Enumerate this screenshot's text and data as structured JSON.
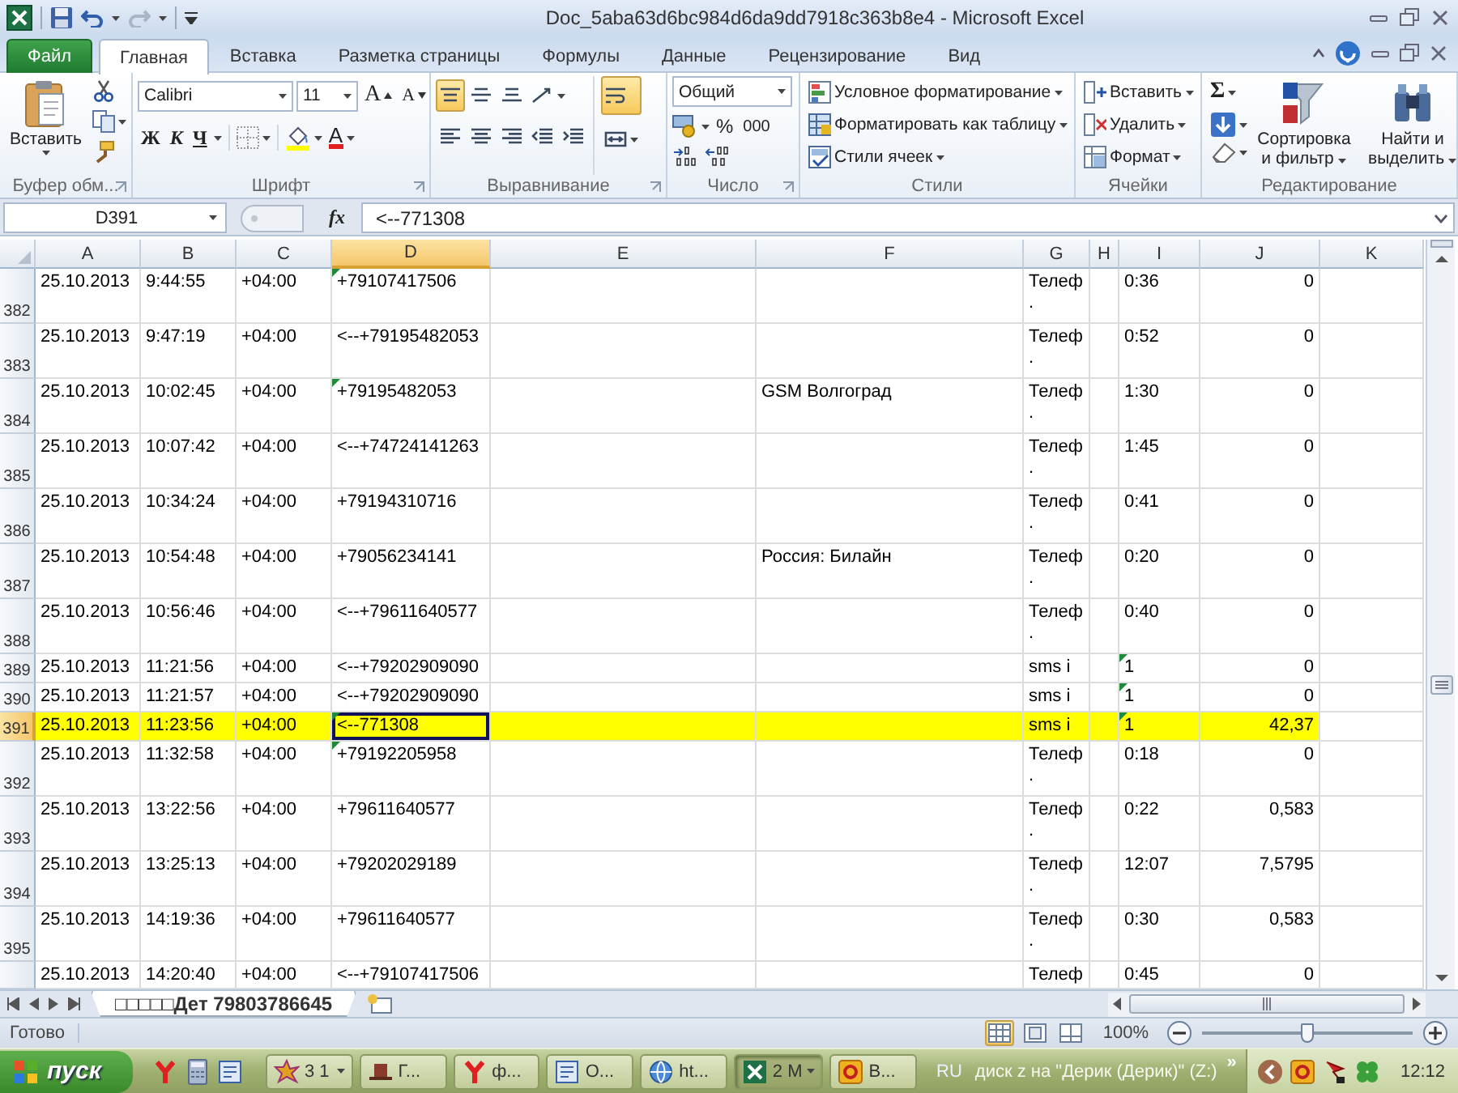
{
  "window": {
    "title": "Doc_5aba63d6bc984d6da9dd7918c363b8e4 - Microsoft Excel"
  },
  "tabs": [
    {
      "label": "Файл",
      "kind": "file",
      "selected": false
    },
    {
      "label": "Главная",
      "kind": "tab",
      "selected": true
    },
    {
      "label": "Вставка",
      "kind": "tab",
      "selected": false
    },
    {
      "label": "Разметка страницы",
      "kind": "tab",
      "selected": false
    },
    {
      "label": "Формулы",
      "kind": "tab",
      "selected": false
    },
    {
      "label": "Данные",
      "kind": "tab",
      "selected": false
    },
    {
      "label": "Рецензирование",
      "kind": "tab",
      "selected": false
    },
    {
      "label": "Вид",
      "kind": "tab",
      "selected": false
    }
  ],
  "ribbon": {
    "clipboard": {
      "label": "Буфер обм...",
      "paste": "Вставить"
    },
    "font": {
      "label": "Шрифт",
      "name": "Calibri",
      "size": "11",
      "grow": "A",
      "shrink": "A",
      "bold": "Ж",
      "italic": "К",
      "underline": "Ч",
      "font_color_label": "A"
    },
    "alignment": {
      "label": "Выравнивание",
      "buttons": [
        {
          "kind": "top",
          "selected": true
        },
        {
          "kind": "middle",
          "selected": false
        },
        {
          "kind": "bottom",
          "selected": false
        },
        {
          "kind": "orientation",
          "selected": false
        },
        {
          "kind": "wrap",
          "selected": true
        },
        {
          "kind": "left",
          "selected": false
        },
        {
          "kind": "center",
          "selected": false
        },
        {
          "kind": "right",
          "selected": false
        },
        {
          "kind": "outdent",
          "selected": false
        },
        {
          "kind": "indent",
          "selected": false
        },
        {
          "kind": "merge",
          "selected": false
        }
      ]
    },
    "number": {
      "label": "Число",
      "format": "Общий",
      "percent": "%",
      "thousands": "000"
    },
    "styles": {
      "label": "Стили",
      "items": [
        "Условное форматирование",
        "Форматировать как таблицу",
        "Стили ячеек"
      ]
    },
    "cells": {
      "label": "Ячейки",
      "items": [
        "Вставить",
        "Удалить",
        "Формат"
      ]
    },
    "editing": {
      "label": "Редактирование",
      "sum": "Σ",
      "sort": "Сортировка и фильтр",
      "find": "Найти и выделить"
    }
  },
  "formula_bar": {
    "name_box": "D391",
    "function_label": "fx",
    "content": "<--771308"
  },
  "sheet": {
    "columns": [
      {
        "label": "A",
        "selected": false
      },
      {
        "label": "B",
        "selected": false
      },
      {
        "label": "C",
        "selected": false
      },
      {
        "label": "D",
        "selected": true
      },
      {
        "label": "E",
        "selected": false
      },
      {
        "label": "F",
        "selected": false
      },
      {
        "label": "G",
        "selected": false
      },
      {
        "label": "H",
        "selected": false
      },
      {
        "label": "I",
        "selected": false
      },
      {
        "label": "J",
        "selected": false,
        "numeric": true
      },
      {
        "label": "K",
        "selected": false
      }
    ],
    "rows": [
      {
        "number": "382",
        "kind": "tall",
        "selected": false,
        "highlighted": false,
        "cells": [
          "25.10.2013",
          "9:44:55",
          "+04:00",
          {
            "text": "+79107417506",
            "flag": true
          },
          null,
          null,
          "Телеф\n.",
          null,
          "0:36",
          "0"
        ]
      },
      {
        "number": "383",
        "kind": "tall",
        "selected": false,
        "highlighted": false,
        "cells": [
          "25.10.2013",
          "9:47:19",
          "+04:00",
          "<--+79195482053",
          null,
          null,
          "Телеф\n.",
          null,
          "0:52",
          "0"
        ]
      },
      {
        "number": "384",
        "kind": "tall",
        "selected": false,
        "highlighted": false,
        "cells": [
          "25.10.2013",
          "10:02:45",
          "+04:00",
          {
            "text": "+79195482053",
            "flag": true
          },
          null,
          "GSM Волгоград",
          "Телеф\n.",
          null,
          "1:30",
          "0"
        ]
      },
      {
        "number": "385",
        "kind": "tall",
        "selected": false,
        "highlighted": false,
        "cells": [
          "25.10.2013",
          "10:07:42",
          "+04:00",
          "<--+74724141263",
          null,
          null,
          "Телеф\n.",
          null,
          "1:45",
          "0"
        ]
      },
      {
        "number": "386",
        "kind": "tall",
        "selected": false,
        "highlighted": false,
        "cells": [
          "25.10.2013",
          "10:34:24",
          "+04:00",
          "+79194310716",
          null,
          null,
          "Телеф\n.",
          null,
          "0:41",
          "0"
        ]
      },
      {
        "number": "387",
        "kind": "tall",
        "selected": false,
        "highlighted": false,
        "cells": [
          "25.10.2013",
          "10:54:48",
          "+04:00",
          "+79056234141",
          null,
          "Россия: Билайн",
          "Телеф\n.",
          null,
          "0:20",
          "0"
        ]
      },
      {
        "number": "388",
        "kind": "tall",
        "selected": false,
        "highlighted": false,
        "cells": [
          "25.10.2013",
          "10:56:46",
          "+04:00",
          "<--+79611640577",
          null,
          null,
          "Телеф\n.",
          null,
          "0:40",
          "0"
        ]
      },
      {
        "number": "389",
        "kind": "short",
        "selected": false,
        "highlighted": false,
        "cells": [
          "25.10.2013",
          "11:21:56",
          "+04:00",
          "<--+79202909090",
          null,
          null,
          "sms i",
          null,
          {
            "text": "1",
            "flag": true
          },
          "0"
        ]
      },
      {
        "number": "390",
        "kind": "short",
        "selected": false,
        "highlighted": false,
        "cells": [
          "25.10.2013",
          "11:21:57",
          "+04:00",
          "<--+79202909090",
          null,
          null,
          "sms i",
          null,
          {
            "text": "1",
            "flag": true
          },
          "0"
        ]
      },
      {
        "number": "391",
        "kind": "short",
        "selected": true,
        "highlighted": true,
        "cells": [
          "25.10.2013",
          "11:23:56",
          "+04:00",
          {
            "text": "<--771308",
            "flag": true
          },
          null,
          null,
          "sms i",
          null,
          {
            "text": "1",
            "flag": true
          },
          "42,37"
        ]
      },
      {
        "number": "392",
        "kind": "tall",
        "selected": false,
        "highlighted": false,
        "cells": [
          "25.10.2013",
          "11:32:58",
          "+04:00",
          {
            "text": "+79192205958",
            "flag": true
          },
          null,
          null,
          "Телеф\n.",
          null,
          "0:18",
          "0"
        ]
      },
      {
        "number": "393",
        "kind": "tall",
        "selected": false,
        "highlighted": false,
        "cells": [
          "25.10.2013",
          "13:22:56",
          "+04:00",
          "+79611640577",
          null,
          null,
          "Телеф\n.",
          null,
          "0:22",
          "0,583"
        ]
      },
      {
        "number": "394",
        "kind": "tall",
        "selected": false,
        "highlighted": false,
        "cells": [
          "25.10.2013",
          "13:25:13",
          "+04:00",
          "+79202029189",
          null,
          null,
          "Телеф\n.",
          null,
          "12:07",
          "7,5795"
        ]
      },
      {
        "number": "395",
        "kind": "tall",
        "selected": false,
        "highlighted": false,
        "cells": [
          "25.10.2013",
          "14:19:36",
          "+04:00",
          "+79611640577",
          null,
          null,
          "Телеф\n.",
          null,
          "0:30",
          "0,583"
        ]
      },
      {
        "kind": "short",
        "selected": false,
        "highlighted": false,
        "cells": [
          "25.10.2013",
          "14:20:40",
          "+04:00",
          "<--+79107417506",
          null,
          null,
          "Телеф",
          null,
          "0:45",
          "0"
        ]
      }
    ]
  },
  "sheet_tabs": [
    {
      "label": "□□□□□Дет 79803786645",
      "selected": true
    }
  ],
  "status_bar": {
    "text": "Готово",
    "views": [
      {
        "kind": "normal",
        "selected": true
      },
      {
        "kind": "layout",
        "selected": false
      },
      {
        "kind": "pagebreak",
        "selected": false
      }
    ],
    "zoom": "100%",
    "zoom_slider": {
      "level": 0.5
    }
  },
  "taskbar": {
    "start": "пуск",
    "tasks": [
      {
        "kind": "star",
        "label": "3 1",
        "caret": true,
        "selected": false
      },
      {
        "kind": "hat",
        "label": "Г...",
        "caret": false,
        "selected": false
      },
      {
        "kind": "y",
        "label": "ф...",
        "caret": false,
        "selected": false
      },
      {
        "kind": "doc",
        "label": "О...",
        "caret": false,
        "selected": false
      },
      {
        "kind": "globe",
        "label": "ht...",
        "caret": false,
        "selected": false
      },
      {
        "kind": "sheet",
        "label": "2 М",
        "caret": true,
        "selected": true
      },
      {
        "kind": "ring",
        "label": "В...",
        "caret": false,
        "selected": false
      }
    ],
    "language": "RU",
    "toolbar": "диск z на \"Дерик (Дерик)\" (Z:)",
    "chevron": "»",
    "clock": "12:12"
  }
}
